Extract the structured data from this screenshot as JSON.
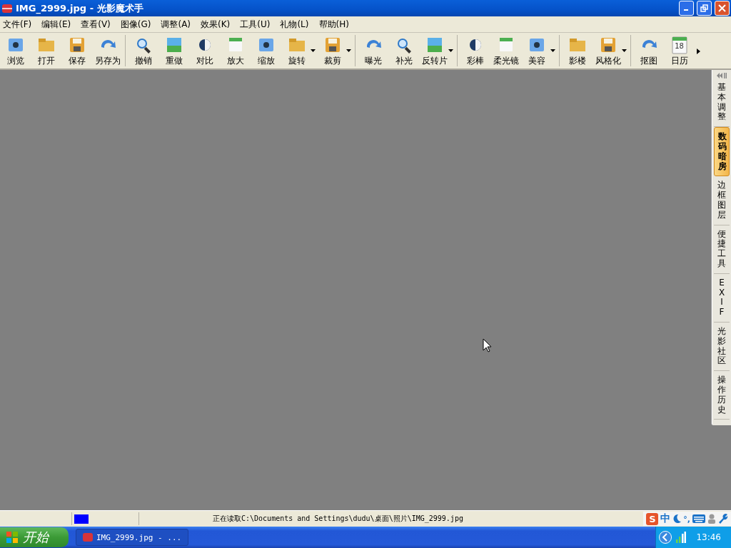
{
  "window": {
    "title": "IMG_2999.jpg - 光影魔术手"
  },
  "menu": [
    "文件(F)",
    "编辑(E)",
    "查看(V)",
    "图像(G)",
    "调整(A)",
    "效果(K)",
    "工具(U)",
    "礼物(L)",
    "帮助(H)"
  ],
  "toolbar": {
    "groups": [
      [
        {
          "label": "浏览",
          "dropdown": false
        },
        {
          "label": "打开",
          "dropdown": false
        },
        {
          "label": "保存",
          "dropdown": false
        },
        {
          "label": "另存为",
          "dropdown": false
        }
      ],
      [
        {
          "label": "撤销",
          "dropdown": false
        },
        {
          "label": "重做",
          "dropdown": false
        },
        {
          "label": "对比",
          "dropdown": false
        },
        {
          "label": "放大",
          "dropdown": false
        },
        {
          "label": "缩放",
          "dropdown": false
        },
        {
          "label": "旋转",
          "dropdown": true
        },
        {
          "label": "裁剪",
          "dropdown": true
        }
      ],
      [
        {
          "label": "曝光",
          "dropdown": false
        },
        {
          "label": "补光",
          "dropdown": false
        },
        {
          "label": "反转片",
          "dropdown": true
        }
      ],
      [
        {
          "label": "彩棒",
          "dropdown": false
        },
        {
          "label": "柔光镜",
          "dropdown": false
        },
        {
          "label": "美容",
          "dropdown": true
        }
      ],
      [
        {
          "label": "影楼",
          "dropdown": false
        },
        {
          "label": "风格化",
          "dropdown": true
        }
      ],
      [
        {
          "label": "抠图",
          "dropdown": false
        },
        {
          "label": "日历",
          "dropdown": false,
          "badge": "18"
        }
      ]
    ]
  },
  "sidebar": {
    "tabs": [
      {
        "label": "基本调整",
        "selected": false
      },
      {
        "label": "数码暗房",
        "selected": true
      },
      {
        "label": "边框图层",
        "selected": false
      },
      {
        "label": "便捷工具",
        "selected": false
      },
      {
        "label": "EXIF",
        "selected": false
      },
      {
        "label": "光影社区",
        "selected": false
      },
      {
        "label": "操作历史",
        "selected": false
      }
    ]
  },
  "status_bar": {
    "swatch": {
      "color": "#0000ff"
    },
    "message": "正在读取C:\\Documents and Settings\\dudu\\桌面\\照片\\IMG_2999.jpg",
    "ime": {
      "logo": "S",
      "mode": "中",
      "punct": "°,"
    }
  },
  "taskbar": {
    "start": "开始",
    "task": "IMG_2999.jpg - ...",
    "clock": "13:46"
  }
}
